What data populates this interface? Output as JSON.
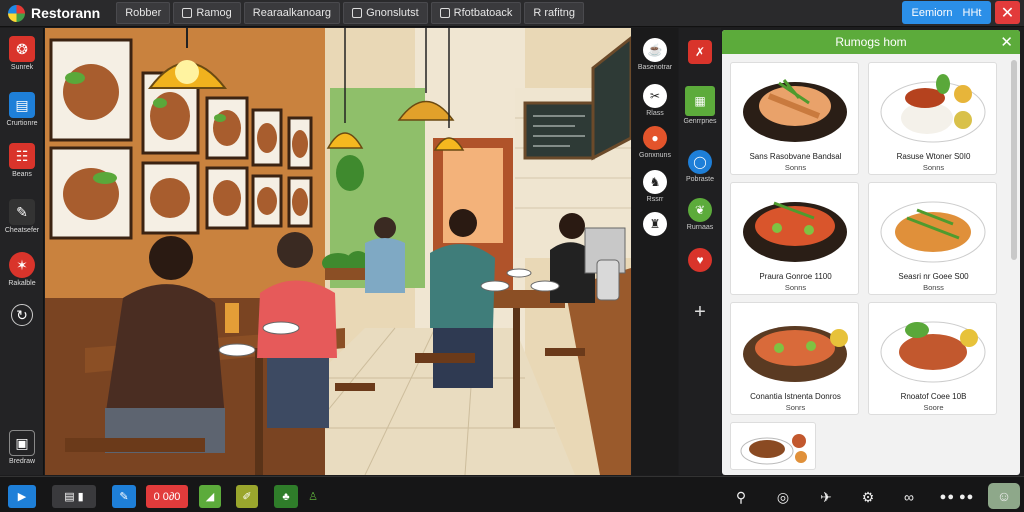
{
  "app": {
    "title": "Restorann"
  },
  "tabs": [
    {
      "label": "Robber"
    },
    {
      "label": "Ramog"
    },
    {
      "label": "Rearaalkanoarg"
    },
    {
      "label": "Gnonslutst"
    },
    {
      "label": "Rfotbatoack"
    },
    {
      "label": "R rafitng"
    }
  ],
  "top_right": {
    "primary_label": "Eemiorn",
    "secondary_label": "HHt"
  },
  "left_sidebar": [
    {
      "label": "Sunrek",
      "icon": "food-icon",
      "color": "#d9342b"
    },
    {
      "label": "Crurtionre",
      "icon": "document-icon",
      "color": "#1e7fd8"
    },
    {
      "label": "Beans",
      "icon": "menu-icon",
      "color": "#d9342b"
    },
    {
      "label": "Cheatsefer",
      "icon": "note-icon",
      "color": "#333"
    },
    {
      "label": "Rakalble",
      "icon": "star-icon",
      "color": "#d9342b"
    },
    {
      "label": "",
      "icon": "refresh-icon",
      "color": "#2a2a2c"
    },
    {
      "label": "Bredraw",
      "icon": "box-icon",
      "color": "#2a2a2c"
    }
  ],
  "tools": [
    {
      "label": "Basenotrar",
      "icon": "tea-icon"
    },
    {
      "label": "Rlass",
      "icon": "utensils-icon"
    },
    {
      "label": "Gonxnuns",
      "icon": "record-icon"
    },
    {
      "label": "Rssrr",
      "icon": "chef-icon"
    },
    {
      "label": "",
      "icon": "diner-icon"
    }
  ],
  "right_icons": [
    {
      "label": "",
      "icon": "close-box-icon",
      "color": "#d9342b"
    },
    {
      "label": "Genrrpnes",
      "icon": "grid-icon",
      "color": "#5cab3b"
    },
    {
      "label": "Pobraste",
      "icon": "circle-icon",
      "color": "#1e7fd8"
    },
    {
      "label": "Rurnaas",
      "icon": "leaf-icon",
      "color": "#5cab3b"
    },
    {
      "label": "",
      "icon": "like-icon",
      "color": "#d9342b"
    },
    {
      "label": "",
      "icon": "plus-icon",
      "color": "transparent"
    }
  ],
  "menu": {
    "title": "Rumogs hom",
    "items": [
      {
        "name": "Sans Rasobvane Bandsal",
        "price": "Sonns"
      },
      {
        "name": "Rasuse Wtoner S0I0",
        "price": "Sonns"
      },
      {
        "name": "Praura Gonroe 1100",
        "price": "Sonns"
      },
      {
        "name": "Seasri nr Goee S00",
        "price": "Bonss"
      },
      {
        "name": "Conantia Istnenta Donros",
        "price": "Sonrs"
      },
      {
        "name": "Rnoatof Coee 10B",
        "price": "Soore"
      },
      {
        "name": "",
        "price": ""
      }
    ]
  },
  "bottom_bar": {
    "left": [
      {
        "label": "",
        "icon": "play-icon",
        "color": "#1e7fd8"
      },
      {
        "label": "",
        "icon": "window-icon",
        "color": "#3a3a3d"
      },
      {
        "label": "",
        "icon": "pencil-icon",
        "color": "#1e7fd8"
      },
      {
        "label": "0 0∂0",
        "icon": "record-icon",
        "color": "#e23b3b"
      },
      {
        "label": "",
        "icon": "tag-icon",
        "color": "#5cab3b"
      },
      {
        "label": "",
        "icon": "note-icon",
        "color": "#9aa62d"
      },
      {
        "label": "",
        "icon": "leaf-icon",
        "color": "#2f7d2a"
      },
      {
        "label": "",
        "icon": "person-icon",
        "color": "transparent"
      }
    ],
    "right": [
      {
        "icon": "magnifier-icon"
      },
      {
        "icon": "search-icon"
      },
      {
        "icon": "share-icon"
      },
      {
        "icon": "settings-icon"
      },
      {
        "icon": "binoculars-icon"
      },
      {
        "icon": "dots-icon"
      },
      {
        "icon": "chat-icon"
      }
    ]
  }
}
